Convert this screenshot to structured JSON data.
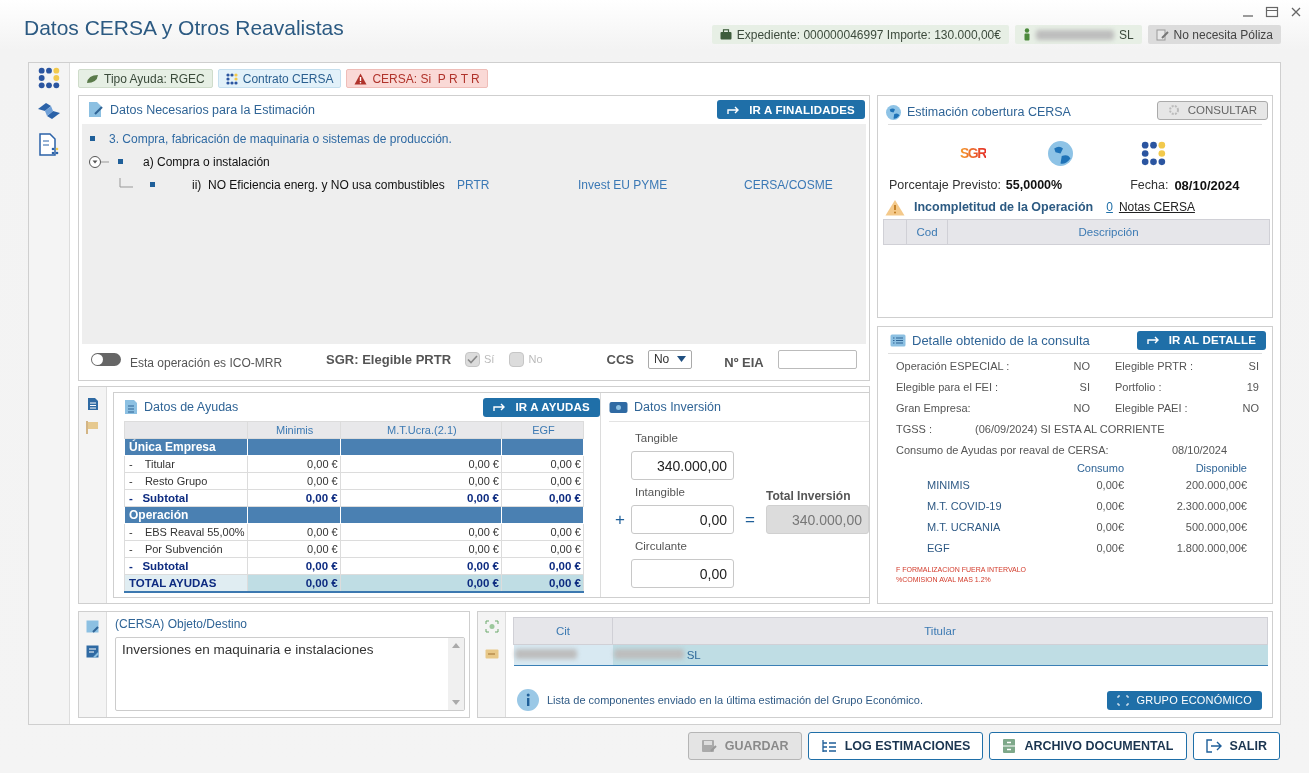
{
  "window": {
    "title": "Datos CERSA y Otros Reavalistas"
  },
  "header_badges": [
    {
      "kind": "expediente",
      "text": "Expediente: 000000046997 Importe: 130.000,00€"
    },
    {
      "kind": "titular",
      "text": "SL"
    },
    {
      "kind": "poliza",
      "text": "No necesita Póliza"
    }
  ],
  "tags": [
    {
      "kind": "ayuda",
      "text": "Tipo Ayuda: RGEC"
    },
    {
      "kind": "contrato",
      "text": "Contrato CERSA"
    },
    {
      "kind": "alerta",
      "text": "CERSA: Si  P R T R"
    }
  ],
  "estimacion": {
    "title": "Datos Necesarios para la Estimación",
    "button": "IR A FINALIDADES",
    "tree": [
      {
        "text": "3. Compra, fabricación de maquinaria o sistemas de producción.",
        "children": [
          {
            "text": "a) Compra o instalación",
            "expanded": true,
            "children": [
              {
                "text": "ii)  NO Eficiencia energ. y NO usa combustibles",
                "flags": [
                  "PRTR",
                  "Invest EU PYME",
                  "CERSA/COSME"
                ]
              }
            ]
          }
        ]
      }
    ],
    "ico_mrr": {
      "label": "Esta operación es ICO-MRR",
      "on": false
    },
    "sgr": {
      "label": "SGR: Elegible PRTR",
      "options": [
        {
          "label": "Sí",
          "checked": true
        },
        {
          "label": "No",
          "checked": false
        }
      ]
    },
    "ccs": {
      "label": "CCS",
      "value": "No"
    },
    "eia": {
      "label": "Nº EIA"
    }
  },
  "cobertura": {
    "title": "Estimación cobertura CERSA",
    "button": "CONSULTAR",
    "button_disabled": true,
    "logo_text": "SGR",
    "porcentaje_label": "Porcentaje Previsto:",
    "porcentaje": "55,0000%",
    "fecha_label": "Fecha:",
    "fecha": "08/10/2024",
    "incompletitud": "Incompletitud de la Operación",
    "notas_count": "0",
    "notas_label": "Notas CERSA",
    "columns": [
      "Cod",
      "Descripción"
    ]
  },
  "ayudas": {
    "title": "Datos de Ayudas",
    "button": "IR A AYUDAS",
    "columns": [
      "Minimis",
      "M.T.Ucra.(2.1)",
      "EGF"
    ],
    "rows": [
      {
        "kind": "section",
        "label": "Única Empresa"
      },
      {
        "kind": "item",
        "label": "-    Titular",
        "values": [
          "0,00 €",
          "0,00 €",
          "0,00 €"
        ]
      },
      {
        "kind": "item",
        "label": "-    Resto Grupo",
        "values": [
          "0,00 €",
          "0,00 €",
          "0,00 €"
        ]
      },
      {
        "kind": "subtotal",
        "label": "-   Subtotal",
        "values": [
          "0,00 €",
          "0,00 €",
          "0,00 €"
        ]
      },
      {
        "kind": "section",
        "label": "Operación"
      },
      {
        "kind": "item",
        "label": "-    EBS Reaval 55,00%",
        "values": [
          "0,00 €",
          "0,00 €",
          "0,00 €"
        ]
      },
      {
        "kind": "item",
        "label": "-    Por Subvención",
        "values": [
          "0,00 €",
          "0,00 €",
          "0,00 €"
        ]
      },
      {
        "kind": "subtotal",
        "label": "-   Subtotal",
        "values": [
          "0,00 €",
          "0,00 €",
          "0,00 €"
        ]
      },
      {
        "kind": "total",
        "label": "TOTAL AYUDAS",
        "values": [
          "0,00 €",
          "0,00 €",
          "0,00 €"
        ]
      }
    ]
  },
  "inversion": {
    "title": "Datos Inversión",
    "fields": [
      {
        "label": "Tangible",
        "value": "340.000,00"
      },
      {
        "label": "Intangible",
        "value": "0,00"
      },
      {
        "label": "Circulante",
        "value": "0,00"
      }
    ],
    "plus": "+",
    "equals": "=",
    "total_label": "Total Inversión",
    "total": "340.000,00"
  },
  "detalle": {
    "title": "Detalle obtenido de la consulta",
    "button": "IR AL DETALLE",
    "pairs": [
      {
        "label": "Operación ESPECIAL :",
        "value": "NO"
      },
      {
        "label": "Elegible PRTR :",
        "value": "SI"
      },
      {
        "label": "Elegible para el FEI :",
        "value": "SI"
      },
      {
        "label": "Portfolio :",
        "value": "19"
      },
      {
        "label": "Gran Empresa:",
        "value": "NO"
      },
      {
        "label": "Elegible PAEI :",
        "value": "NO"
      }
    ],
    "tgss": {
      "label": "TGSS :",
      "value": "(06/09/2024) SI ESTA AL CORRIENTE"
    },
    "consumo": {
      "label": "Consumo de Ayudas por reaval de CERSA:",
      "date": "08/10/2024",
      "columns": [
        "Consumo",
        "Disponible"
      ],
      "rows": [
        {
          "name": "MINIMIS",
          "consumo": "0,00€",
          "disponible": "200.000,00€"
        },
        {
          "name": "M.T. COVID-19",
          "consumo": "0,00€",
          "disponible": "2.300.000,00€"
        },
        {
          "name": "M.T. UCRANIA",
          "consumo": "0,00€",
          "disponible": "500.000,00€"
        },
        {
          "name": "EGF",
          "consumo": "0,00€",
          "disponible": "1.800.000,00€"
        }
      ]
    },
    "notes": [
      "F FORMALIZACION FUERA INTERVALO",
      "%COMISION AVAL MAS 1.2%"
    ]
  },
  "objeto": {
    "title": "(CERSA) Objeto/Destino",
    "value": "Inversiones en maquinaria e instalaciones"
  },
  "grupo": {
    "columns": [
      "Cit",
      "Titular"
    ],
    "rows": [
      {
        "titular": "SL",
        "selected": true
      }
    ],
    "info": "Lista de componentes enviado en la última estimación del Grupo Económico.",
    "button": "GRUPO ECONÓMICO"
  },
  "footer_buttons": [
    {
      "kind": "save",
      "label": "GUARDAR",
      "disabled": true
    },
    {
      "kind": "log",
      "label": "LOG ESTIMACIONES",
      "disabled": false
    },
    {
      "kind": "archive",
      "label": "ARCHIVO DOCUMENTAL",
      "disabled": false
    },
    {
      "kind": "exit",
      "label": "SALIR",
      "disabled": false
    }
  ]
}
